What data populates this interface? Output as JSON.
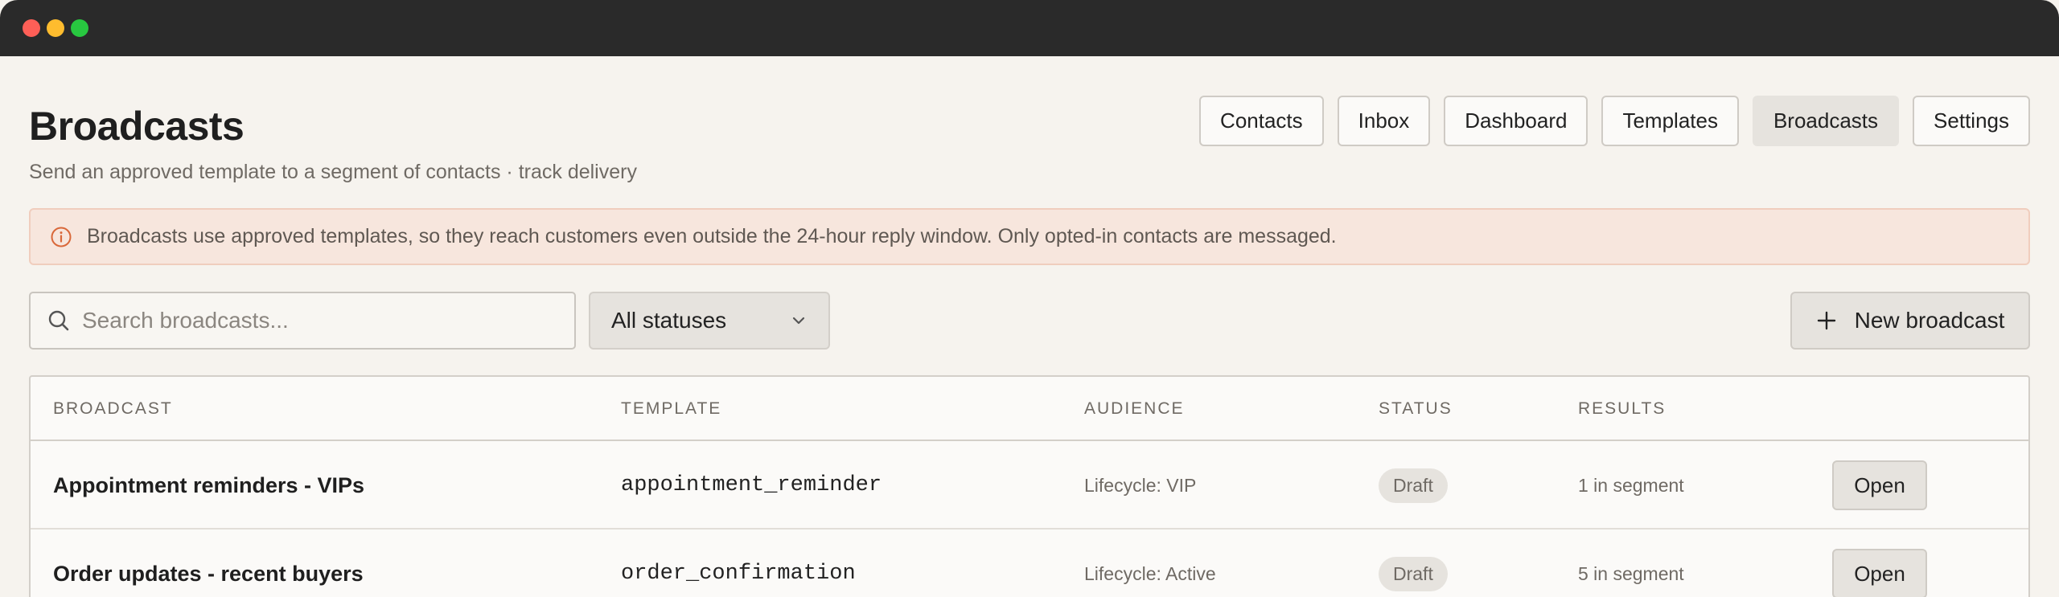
{
  "header": {
    "title": "Broadcasts",
    "subtitle": "Send an approved template to a segment of contacts · track delivery"
  },
  "nav": {
    "items": [
      {
        "label": "Contacts",
        "active": false
      },
      {
        "label": "Inbox",
        "active": false
      },
      {
        "label": "Dashboard",
        "active": false
      },
      {
        "label": "Templates",
        "active": false
      },
      {
        "label": "Broadcasts",
        "active": true
      },
      {
        "label": "Settings",
        "active": false
      }
    ]
  },
  "banner": {
    "icon": "info-circle-icon",
    "text": "Broadcasts use approved templates, so they reach customers even outside the 24-hour reply window. Only opted-in contacts are messaged.",
    "background": "#f7e6dd",
    "icon_color": "#d9683a"
  },
  "toolbar": {
    "search_placeholder": "Search broadcasts...",
    "search_value": "",
    "status_filter": "All statuses",
    "new_button": "New broadcast"
  },
  "table": {
    "columns": [
      "BROADCAST",
      "TEMPLATE",
      "AUDIENCE",
      "STATUS",
      "RESULTS"
    ],
    "rows": [
      {
        "name": "Appointment reminders - VIPs",
        "template": "appointment_reminder",
        "audience": "Lifecycle: VIP",
        "status": "Draft",
        "results": "1 in segment",
        "action": "Open"
      },
      {
        "name": "Order updates - recent buyers",
        "template": "order_confirmation",
        "audience": "Lifecycle: Active",
        "status": "Draft",
        "results": "5 in segment",
        "action": "Open"
      }
    ]
  }
}
